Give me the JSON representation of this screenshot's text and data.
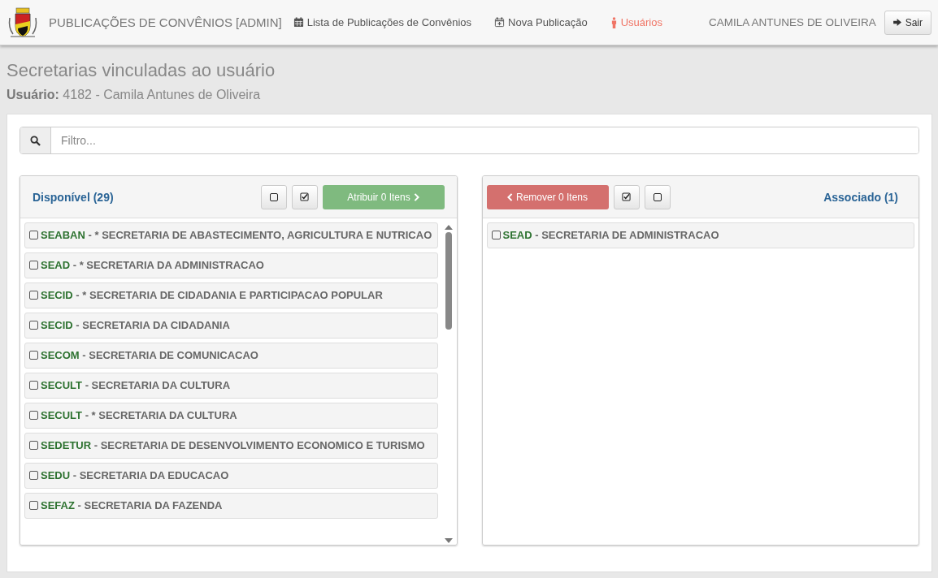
{
  "header": {
    "app_title": "PUBLICAÇÕES DE CONVÊNIOS [ADMIN]",
    "nav": [
      {
        "label": "Lista de Publicações de Convênios",
        "selected": false
      },
      {
        "label": "Nova Publicação",
        "selected": false
      },
      {
        "label": "Usuários",
        "selected": true
      }
    ],
    "user_name": "CAMILA ANTUNES DE OLIVEIRA",
    "logout_button": "Sair"
  },
  "page_title": "Secretarias vinculadas ao usuário",
  "user_line": {
    "label": "Usuário:",
    "value": "4182 - Camila Antunes de Oliveira"
  },
  "filter": {
    "placeholder": "Filtro..."
  },
  "available": {
    "title": "Disponível (29)",
    "action_button": "Atribuir 0 Itens",
    "items": [
      {
        "code": "SEABAN",
        "name": "- * SECRETARIA DE ABASTECIMENTO, AGRICULTURA E NUTRICAO",
        "checked": false
      },
      {
        "code": "SEAD",
        "name": "- * SECRETARIA DA ADMINISTRACAO",
        "checked": false
      },
      {
        "code": "SECID",
        "name": "- * SECRETARIA DE CIDADANIA E PARTICIPACAO POPULAR",
        "checked": false
      },
      {
        "code": "SECID",
        "name": "- SECRETARIA DA CIDADANIA",
        "checked": false
      },
      {
        "code": "SECOM",
        "name": "- SECRETARIA DE COMUNICACAO",
        "checked": false
      },
      {
        "code": "SECULT",
        "name": "- SECRETARIA DA CULTURA",
        "checked": false
      },
      {
        "code": "SECULT",
        "name": "- * SECRETARIA DA CULTURA",
        "checked": false
      },
      {
        "code": "SEDETUR",
        "name": "- SECRETARIA DE DESENVOLVIMENTO ECONOMICO E TURISMO",
        "checked": false
      },
      {
        "code": "SEDU",
        "name": "- SECRETARIA DA EDUCACAO",
        "checked": false
      },
      {
        "code": "SEFAZ",
        "name": "- SECRETARIA DA FAZENDA",
        "checked": false
      }
    ]
  },
  "associated": {
    "title": "Associado (1)",
    "action_button": "Remover 0 Itens",
    "items": [
      {
        "code": "SEAD",
        "name": "- SECRETARIA DE ADMINISTRACAO",
        "checked": false
      }
    ]
  }
}
